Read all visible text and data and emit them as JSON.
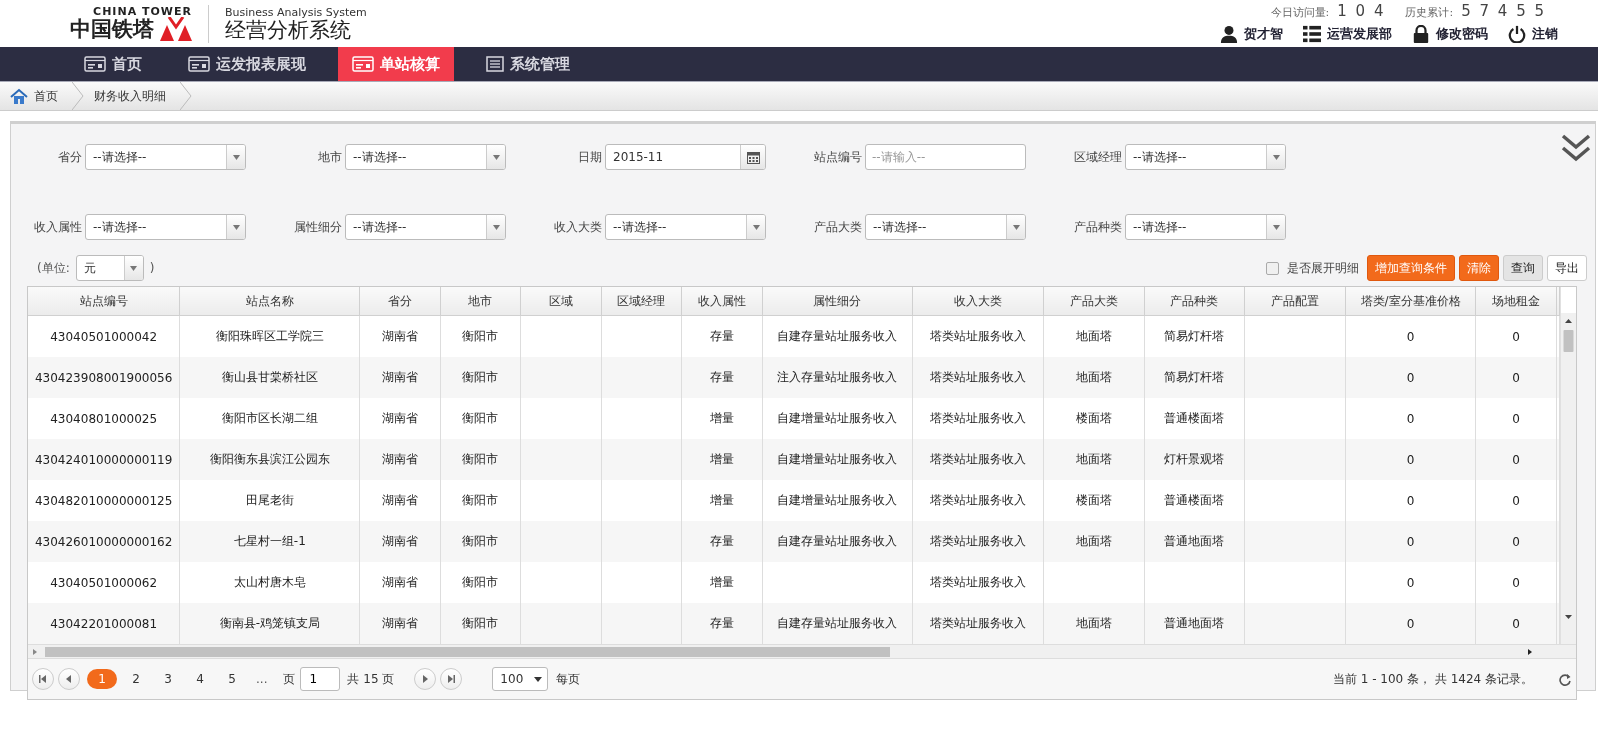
{
  "header": {
    "logo_en": "CHINA TOWER",
    "logo_cn": "中国铁塔",
    "system_en": "Business Analysis System",
    "system_cn": "经营分析系统",
    "today_label": "今日访问量:",
    "today_count": "1 0 4",
    "total_label": "历史累计:",
    "total_count": "5 7 4 5 5",
    "user_links": [
      {
        "kind": "user",
        "label": "贺才智"
      },
      {
        "kind": "dept",
        "label": "运营发展部"
      },
      {
        "kind": "password",
        "label": "修改密码"
      },
      {
        "kind": "logout",
        "label": "注销"
      }
    ]
  },
  "nav": [
    {
      "kind": "card",
      "label": "首页",
      "selected": false
    },
    {
      "kind": "card",
      "label": "运发报表展现",
      "selected": false
    },
    {
      "kind": "card",
      "label": "单站核算",
      "selected": true
    },
    {
      "kind": "list",
      "label": "系统管理",
      "selected": false
    }
  ],
  "breadcrumb": [
    "首页",
    "财务收入明细"
  ],
  "filters": [
    {
      "kind": "select",
      "label": "省分",
      "value": "--请选择--"
    },
    {
      "kind": "select",
      "label": "地市",
      "value": "--请选择--"
    },
    {
      "kind": "date",
      "label": "日期",
      "value": "2015-11"
    },
    {
      "kind": "text",
      "label": "站点编号",
      "placeholder": "--请输入--"
    },
    {
      "kind": "select",
      "label": "区域经理",
      "value": "--请选择--"
    },
    {
      "kind": "select",
      "label": "收入属性",
      "value": "--请选择--"
    },
    {
      "kind": "select",
      "label": "属性细分",
      "value": "--请选择--"
    },
    {
      "kind": "select",
      "label": "收入大类",
      "value": "--请选择--"
    },
    {
      "kind": "select",
      "label": "产品大类",
      "value": "--请选择--"
    },
    {
      "kind": "select",
      "label": "产品种类",
      "value": "--请选择--"
    }
  ],
  "unit": {
    "prefix": "(单位:",
    "value": "元",
    "suffix": ")"
  },
  "expand_detail": {
    "label": "是否展开明细",
    "checked": false
  },
  "buttons": [
    {
      "kind": "primary",
      "label": "增加查询条件"
    },
    {
      "kind": "primary",
      "label": "清除"
    },
    {
      "kind": "secondary",
      "label": "查询"
    },
    {
      "kind": "plain",
      "label": "导出"
    }
  ],
  "table": {
    "columns": [
      "站点编号",
      "站点名称",
      "省分",
      "地市",
      "区域",
      "区域经理",
      "收入属性",
      "属性细分",
      "收入大类",
      "产品大类",
      "产品种类",
      "产品配置",
      "塔类/室分基准价格",
      "场地租金"
    ],
    "rows": [
      [
        "43040501000042",
        "衡阳珠晖区工学院三",
        "湖南省",
        "衡阳市",
        null,
        null,
        "存量",
        "自建存量站址服务收入",
        "塔类站址服务收入",
        "地面塔",
        "简易灯杆塔",
        null,
        "0",
        "0"
      ],
      [
        "430423908001900056",
        "衡山县甘棠桥社区",
        "湖南省",
        "衡阳市",
        null,
        null,
        "存量",
        "注入存量站址服务收入",
        "塔类站址服务收入",
        "地面塔",
        "简易灯杆塔",
        null,
        "0",
        "0"
      ],
      [
        "43040801000025",
        "衡阳市区长湖二组",
        "湖南省",
        "衡阳市",
        null,
        null,
        "增量",
        "自建增量站址服务收入",
        "塔类站址服务收入",
        "楼面塔",
        "普通楼面塔",
        null,
        "0",
        "0"
      ],
      [
        "430424010000000119",
        "衡阳衡东县滨江公园东",
        "湖南省",
        "衡阳市",
        null,
        null,
        "增量",
        "自建增量站址服务收入",
        "塔类站址服务收入",
        "地面塔",
        "灯杆景观塔",
        null,
        "0",
        "0"
      ],
      [
        "430482010000000125",
        "田尾老街",
        "湖南省",
        "衡阳市",
        null,
        null,
        "增量",
        "自建增量站址服务收入",
        "塔类站址服务收入",
        "楼面塔",
        "普通楼面塔",
        null,
        "0",
        "0"
      ],
      [
        "430426010000000162",
        "七星村一组-1",
        "湖南省",
        "衡阳市",
        null,
        null,
        "存量",
        "自建存量站址服务收入",
        "塔类站址服务收入",
        "地面塔",
        "普通地面塔",
        null,
        "0",
        "0"
      ],
      [
        "43040501000062",
        "太山村唐木皂",
        "湖南省",
        "衡阳市",
        null,
        null,
        "增量",
        null,
        "塔类站址服务收入",
        null,
        null,
        null,
        "0",
        "0"
      ],
      [
        "43042201000081",
        "衡南县-鸡笼镇支局",
        "湖南省",
        "衡阳市",
        null,
        null,
        "存量",
        "自建存量站址服务收入",
        "塔类站址服务收入",
        "地面塔",
        "普通地面塔",
        null,
        "0",
        "0"
      ]
    ]
  },
  "pagination": {
    "pages": [
      {
        "label": "1",
        "selected": true
      },
      {
        "label": "2",
        "selected": false
      },
      {
        "label": "3",
        "selected": false
      },
      {
        "label": "4",
        "selected": false
      },
      {
        "label": "5",
        "selected": false
      }
    ],
    "ellipsis": "...",
    "page_label": "页",
    "page_value": "1",
    "total_pages": "共 15 页",
    "page_size": "100",
    "per_page": "每页",
    "summary": "当前 1 - 100 条， 共 1424 条记录。"
  }
}
